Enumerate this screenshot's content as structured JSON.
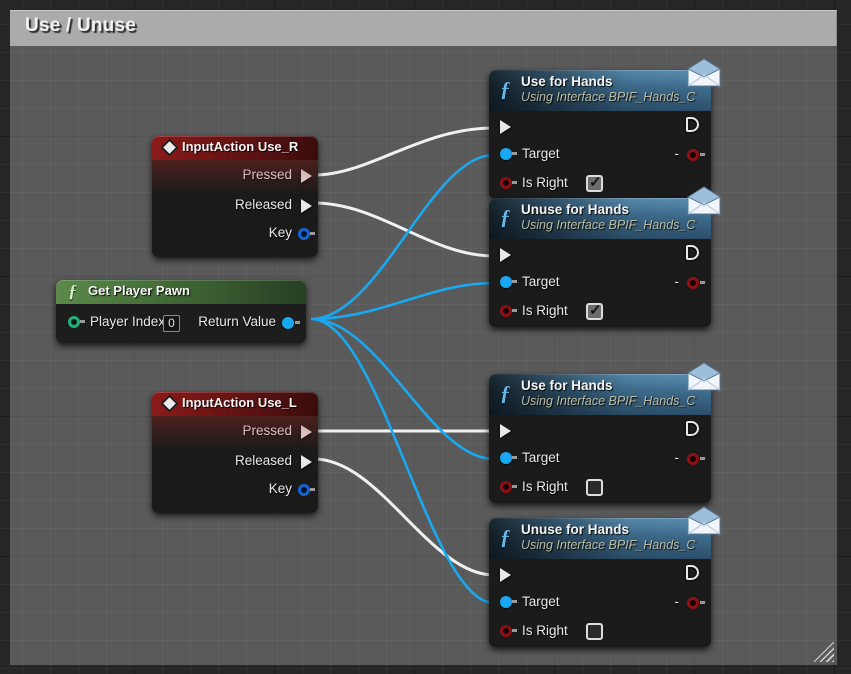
{
  "graph": {
    "app": "Unreal Engine Blueprint Graph",
    "background_color": "#262626",
    "grid_color": "#333333"
  },
  "comment": {
    "title": "Use / Unuse",
    "bar_color": "#ababab",
    "body_color": "#6e6e6e",
    "resize_handle": "resize-grip-icon"
  },
  "wire_colors": {
    "exec": "#f0f0f0",
    "object": "#19a9f0"
  },
  "nodes": [
    {
      "id": "use_r",
      "kind": "event",
      "icon": "diamond-icon",
      "title": "InputAction Use_R",
      "outputs": [
        {
          "label": "Pressed",
          "pin": "exec-out-filled"
        },
        {
          "label": "Released",
          "pin": "exec-out-filled"
        },
        {
          "label": "Key",
          "pin": "struct-blue-dot"
        }
      ]
    },
    {
      "id": "use_l",
      "kind": "event",
      "icon": "diamond-icon",
      "title": "InputAction Use_L",
      "outputs": [
        {
          "label": "Pressed",
          "pin": "exec-out-filled"
        },
        {
          "label": "Released",
          "pin": "exec-out-filled"
        },
        {
          "label": "Key",
          "pin": "struct-blue-dot"
        }
      ]
    },
    {
      "id": "get_player_pawn",
      "kind": "pure-function",
      "icon": "function-f-icon",
      "title": "Get Player Pawn",
      "inputs": [
        {
          "label": "Player Index",
          "pin": "int-green-dot",
          "value": "0"
        }
      ],
      "outputs": [
        {
          "label": "Return Value",
          "pin": "object-blue-dot"
        }
      ]
    },
    {
      "id": "use_hands_r",
      "kind": "interface-function",
      "icon": "function-f-icon",
      "badge": "envelope-icon",
      "title": "Use for Hands",
      "subtitle": "Using Interface BPIF_Hands_C",
      "inputs": [
        {
          "label": "",
          "pin": "exec-in"
        },
        {
          "label": "Target",
          "pin": "object-blue-dot"
        },
        {
          "label": "Is Right",
          "pin": "bool-red-dot",
          "checkbox": true
        }
      ],
      "outputs": [
        {
          "label": "",
          "pin": "exec-out"
        },
        {
          "label": "-",
          "pin": "bool-red-dot"
        }
      ]
    },
    {
      "id": "unuse_hands_r",
      "kind": "interface-function",
      "icon": "function-f-icon",
      "badge": "envelope-icon",
      "title": "Unuse for Hands",
      "subtitle": "Using Interface BPIF_Hands_C",
      "inputs": [
        {
          "label": "",
          "pin": "exec-in"
        },
        {
          "label": "Target",
          "pin": "object-blue-dot"
        },
        {
          "label": "Is Right",
          "pin": "bool-red-dot",
          "checkbox": true
        }
      ],
      "outputs": [
        {
          "label": "",
          "pin": "exec-out"
        },
        {
          "label": "-",
          "pin": "bool-red-dot"
        }
      ]
    },
    {
      "id": "use_hands_l",
      "kind": "interface-function",
      "icon": "function-f-icon",
      "badge": "envelope-icon",
      "title": "Use for Hands",
      "subtitle": "Using Interface BPIF_Hands_C",
      "inputs": [
        {
          "label": "",
          "pin": "exec-in"
        },
        {
          "label": "Target",
          "pin": "object-blue-dot"
        },
        {
          "label": "Is Right",
          "pin": "bool-red-dot",
          "checkbox": false
        }
      ],
      "outputs": [
        {
          "label": "",
          "pin": "exec-out"
        },
        {
          "label": "-",
          "pin": "bool-red-dot"
        }
      ]
    },
    {
      "id": "unuse_hands_l",
      "kind": "interface-function",
      "icon": "function-f-icon",
      "badge": "envelope-icon",
      "title": "Unuse for Hands",
      "subtitle": "Using Interface BPIF_Hands_C",
      "inputs": [
        {
          "label": "",
          "pin": "exec-in"
        },
        {
          "label": "Target",
          "pin": "object-blue-dot"
        },
        {
          "label": "Is Right",
          "pin": "bool-red-dot",
          "checkbox": false
        }
      ],
      "outputs": [
        {
          "label": "",
          "pin": "exec-out"
        },
        {
          "label": "-",
          "pin": "bool-red-dot"
        }
      ]
    }
  ]
}
